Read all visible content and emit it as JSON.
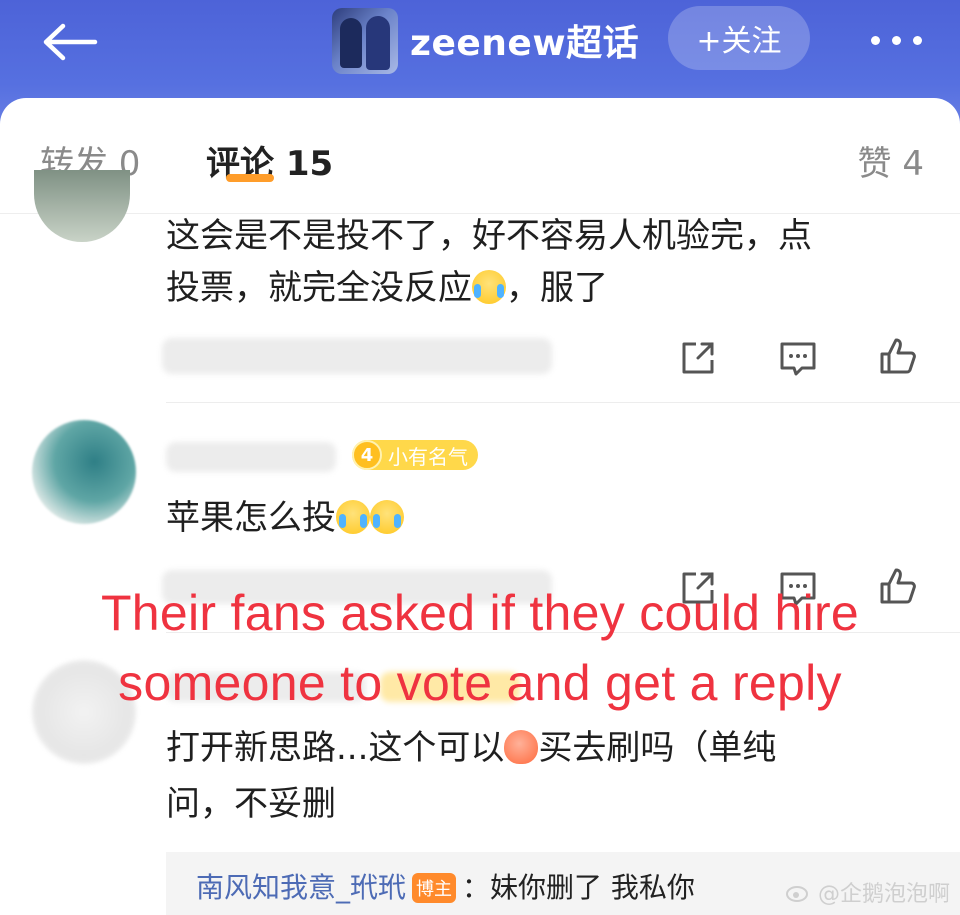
{
  "header": {
    "title": "zeenew超话",
    "follow_label": "+关注",
    "back_icon": "back-arrow-icon",
    "more_icon": "more-dots-icon",
    "colors": {
      "header_bg": "#4d63d8",
      "accent": "#ff9d2a"
    }
  },
  "tabs": [
    {
      "label": "转发 0"
    },
    {
      "label": "评论 15",
      "active": true
    },
    {
      "label": "赞 4"
    }
  ],
  "comments": [
    {
      "text_line1": "这会是不是投不了，好不容易人机验完，点",
      "text_line2": "投票，就完全没反应",
      "text_tail": "，服了",
      "emoji": "laughing-crying-icon"
    },
    {
      "badge_level": "4",
      "badge_label": "小有名气",
      "text": "苹果怎么投",
      "emoji": "crying-icon"
    },
    {
      "text_line1_a": "打开新思路...这个可以",
      "text_line1_b": "买去刷吗（单纯",
      "text_line2": "问，不妥删",
      "emoji": "peach-icon"
    }
  ],
  "reply": {
    "user": "南风知我意_玳玳",
    "badge": "博主",
    "text": "：妹你删了 我私你"
  },
  "overlay": {
    "line1": "Their fans asked if they could hire",
    "line2": "someone to vote and get a reply",
    "color": "#ef3340"
  },
  "watermark": "@企鹅泡泡啊"
}
